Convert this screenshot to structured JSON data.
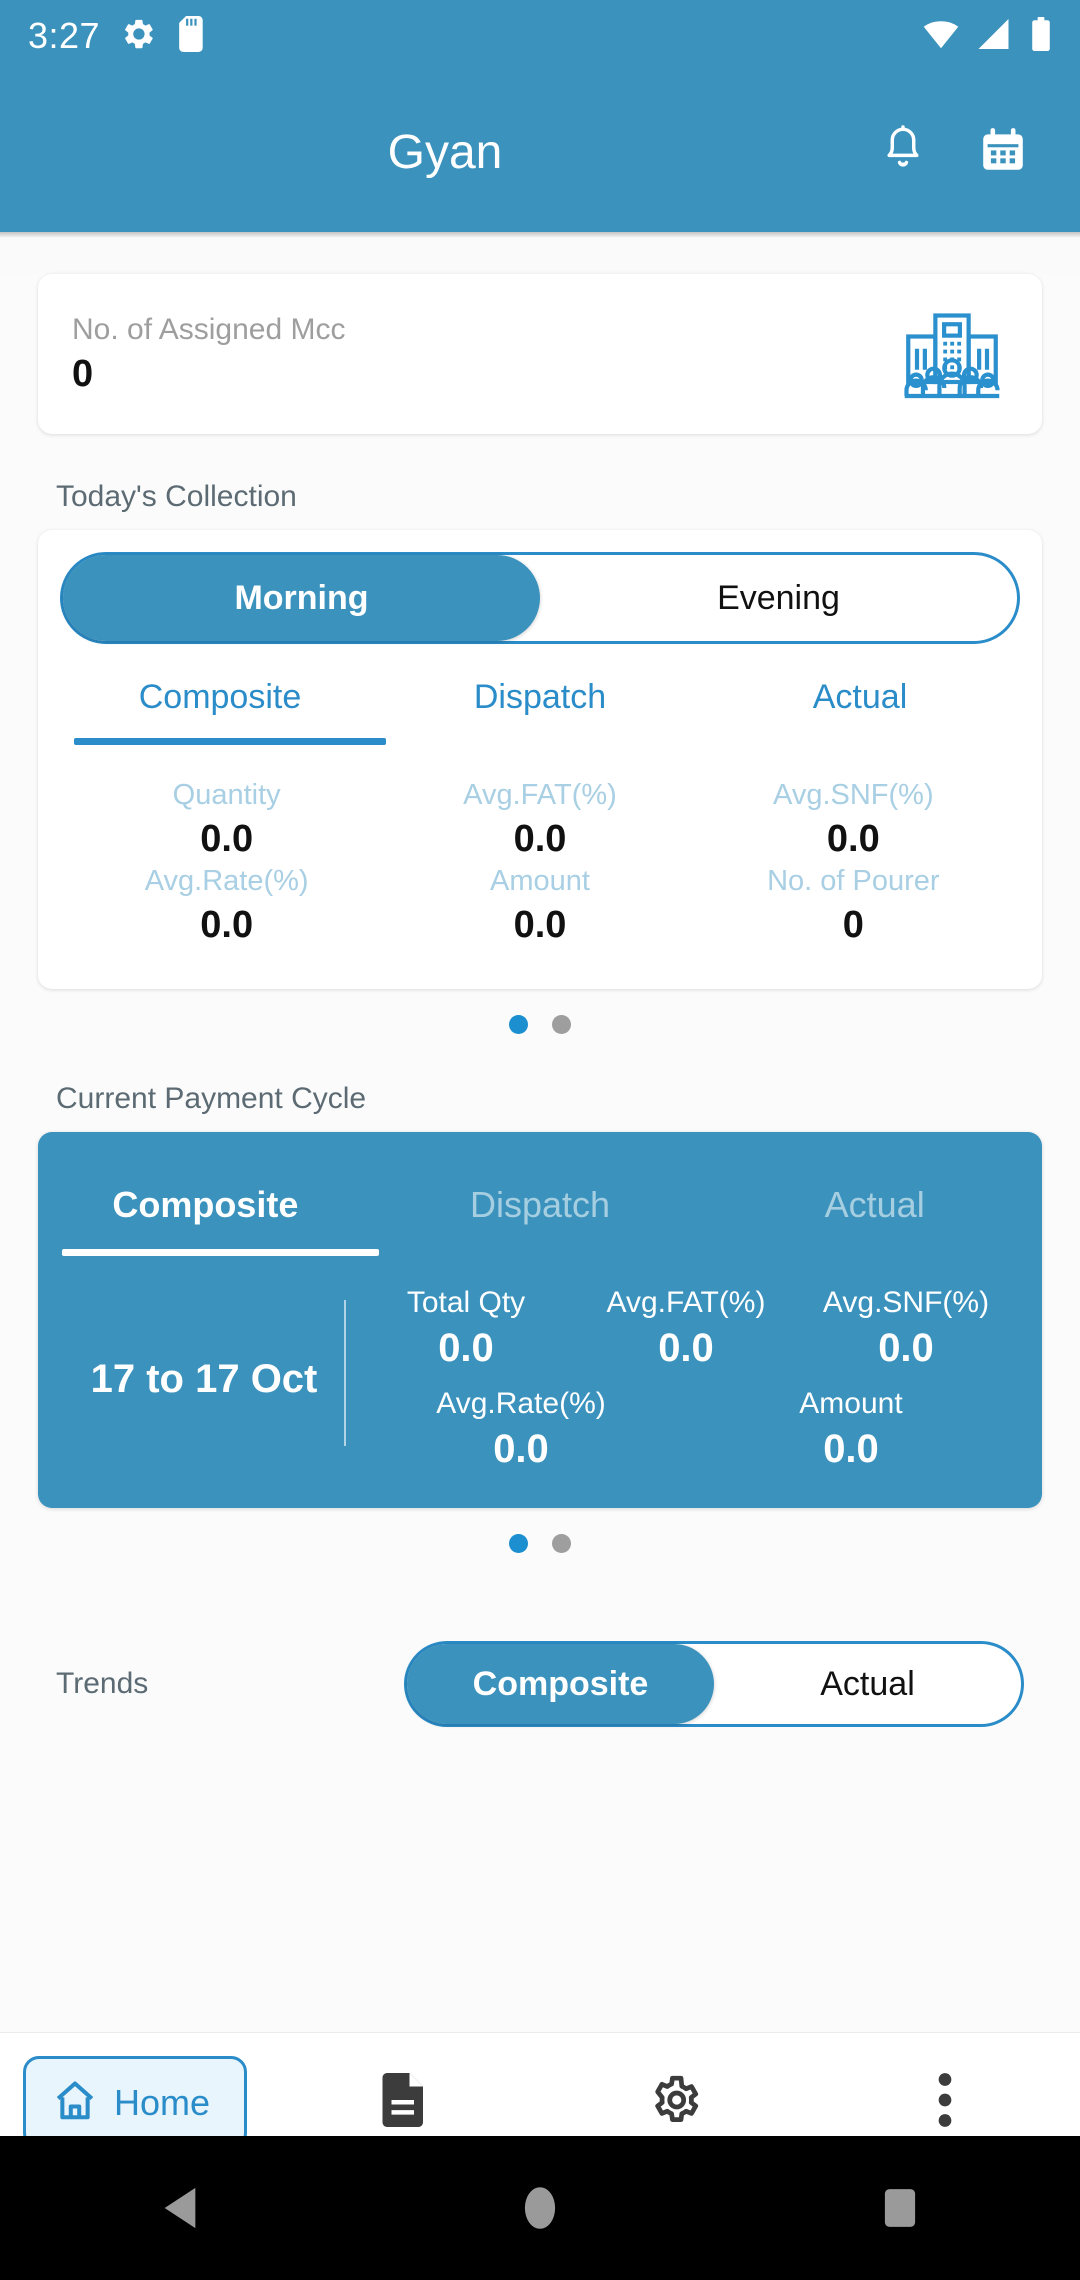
{
  "status_bar": {
    "time": "3:27",
    "left_icons": [
      "gear-icon",
      "sd-card-icon"
    ],
    "right_icons": [
      "wifi-icon",
      "signal-icon",
      "battery-icon"
    ]
  },
  "app_bar": {
    "title": "Gyan",
    "actions": [
      "notification-bell-icon",
      "calendar-icon"
    ],
    "background_color": "#3a92bd"
  },
  "mcc_card": {
    "label": "No. of Assigned Mcc",
    "value": "0",
    "icon": "mcc-building-people-icon"
  },
  "todays_collection": {
    "section_title": "Today's Collection",
    "shift_toggle": {
      "options": [
        "Morning",
        "Evening"
      ],
      "selected": "Morning"
    },
    "tabs": [
      "Composite",
      "Dispatch",
      "Actual"
    ],
    "active_tab": "Composite",
    "stats": [
      {
        "key": "Quantity",
        "value": "0.0"
      },
      {
        "key": "Avg.FAT(%)",
        "value": "0.0"
      },
      {
        "key": "Avg.SNF(%)",
        "value": "0.0"
      },
      {
        "key": "Avg.Rate(%)",
        "value": "0.0"
      },
      {
        "key": "Amount",
        "value": "0.0"
      },
      {
        "key": "No. of Pourer",
        "value": "0"
      }
    ],
    "pager": {
      "count": 2,
      "active_index": 0
    }
  },
  "current_payment_cycle": {
    "section_title": "Current Payment Cycle",
    "tabs": [
      "Composite",
      "Dispatch",
      "Actual"
    ],
    "active_tab": "Composite",
    "date_range": "17 to 17 Oct",
    "stats": [
      {
        "key": "Total Qty",
        "value": "0.0"
      },
      {
        "key": "Avg.FAT(%)",
        "value": "0.0"
      },
      {
        "key": "Avg.SNF(%)",
        "value": "0.0"
      },
      {
        "key": "Avg.Rate(%)",
        "value": "0.0"
      },
      {
        "key": "Amount",
        "value": "0.0"
      }
    ],
    "pager": {
      "count": 2,
      "active_index": 0
    },
    "background_color": "#3a92bd"
  },
  "trends": {
    "label": "Trends",
    "toggle": {
      "options": [
        "Composite",
        "Actual"
      ],
      "selected": "Composite"
    }
  },
  "bottom_nav": {
    "items": [
      {
        "label": "Home",
        "icon": "home-icon",
        "active": true
      },
      {
        "label": "",
        "icon": "document-icon",
        "active": false
      },
      {
        "label": "",
        "icon": "gear-icon",
        "active": false
      },
      {
        "label": "",
        "icon": "more-vertical-icon",
        "active": false
      }
    ]
  },
  "android_nav": {
    "buttons": [
      "back-icon",
      "home-circle-icon",
      "recents-square-icon"
    ]
  },
  "colors": {
    "primary": "#3a92bd",
    "accent": "#2a8cc8",
    "muted_label": "#a8cfe3",
    "grey_label": "#9e9e9e"
  }
}
